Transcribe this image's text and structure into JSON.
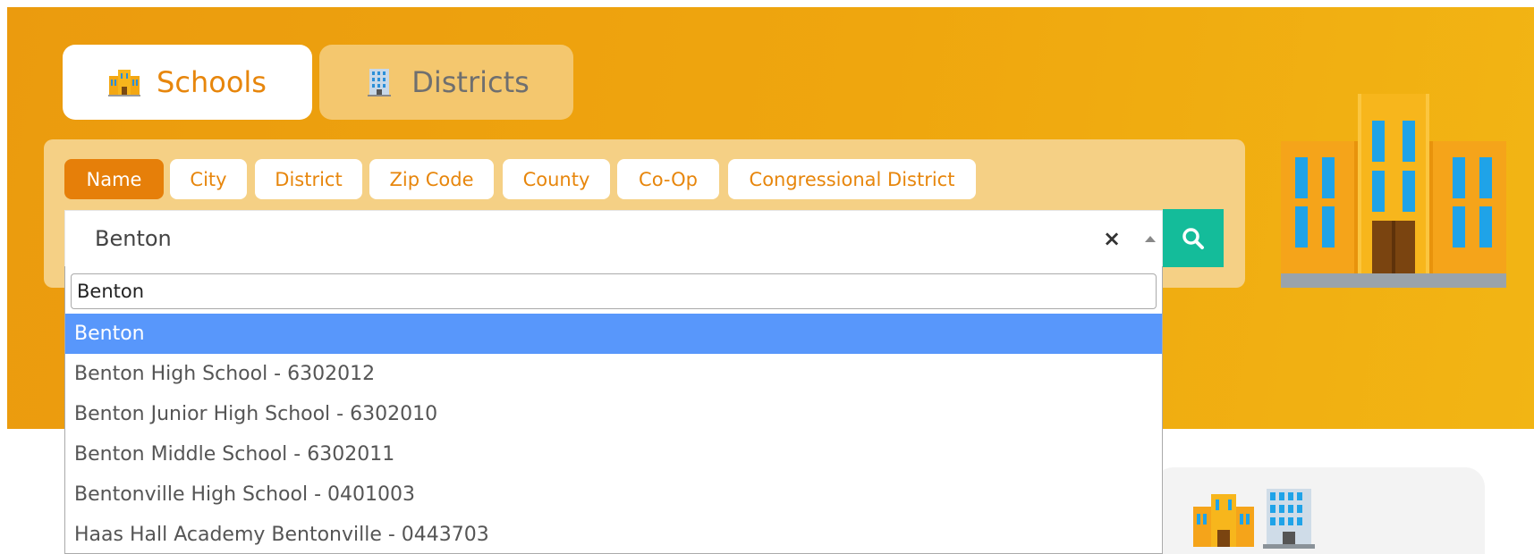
{
  "tabs": [
    {
      "label": "Schools",
      "active": true,
      "icon": "school-building-icon"
    },
    {
      "label": "Districts",
      "active": false,
      "icon": "office-building-icon"
    }
  ],
  "filters": [
    {
      "label": "Name",
      "active": true
    },
    {
      "label": "City",
      "active": false
    },
    {
      "label": "District",
      "active": false
    },
    {
      "label": "Zip Code",
      "active": false
    },
    {
      "label": "County",
      "active": false
    },
    {
      "label": "Co-Op",
      "active": false
    },
    {
      "label": "Congressional District",
      "active": false
    }
  ],
  "select": {
    "value": "Benton",
    "clear_label": "×",
    "dropdown_search_value": "Benton",
    "options": [
      "Benton",
      "Benton High School - 6302012",
      "Benton Junior High School - 6302010",
      "Benton Middle School - 6302011",
      "Bentonville High School - 0401003",
      "Haas Hall Academy Bentonville - 0443703"
    ],
    "highlighted_index": 0
  },
  "icons": {
    "search_button": "search-icon",
    "dropdown_toggle": "caret-up-icon",
    "hero_illustration": "school-building-illustration",
    "card_icons": [
      "school-building-icon",
      "office-building-icon"
    ]
  },
  "colors": {
    "hero_orange": "#efa60e",
    "accent_orange": "#e67f09",
    "search_green": "#14bc9a",
    "highlight_blue": "#5897fb"
  }
}
